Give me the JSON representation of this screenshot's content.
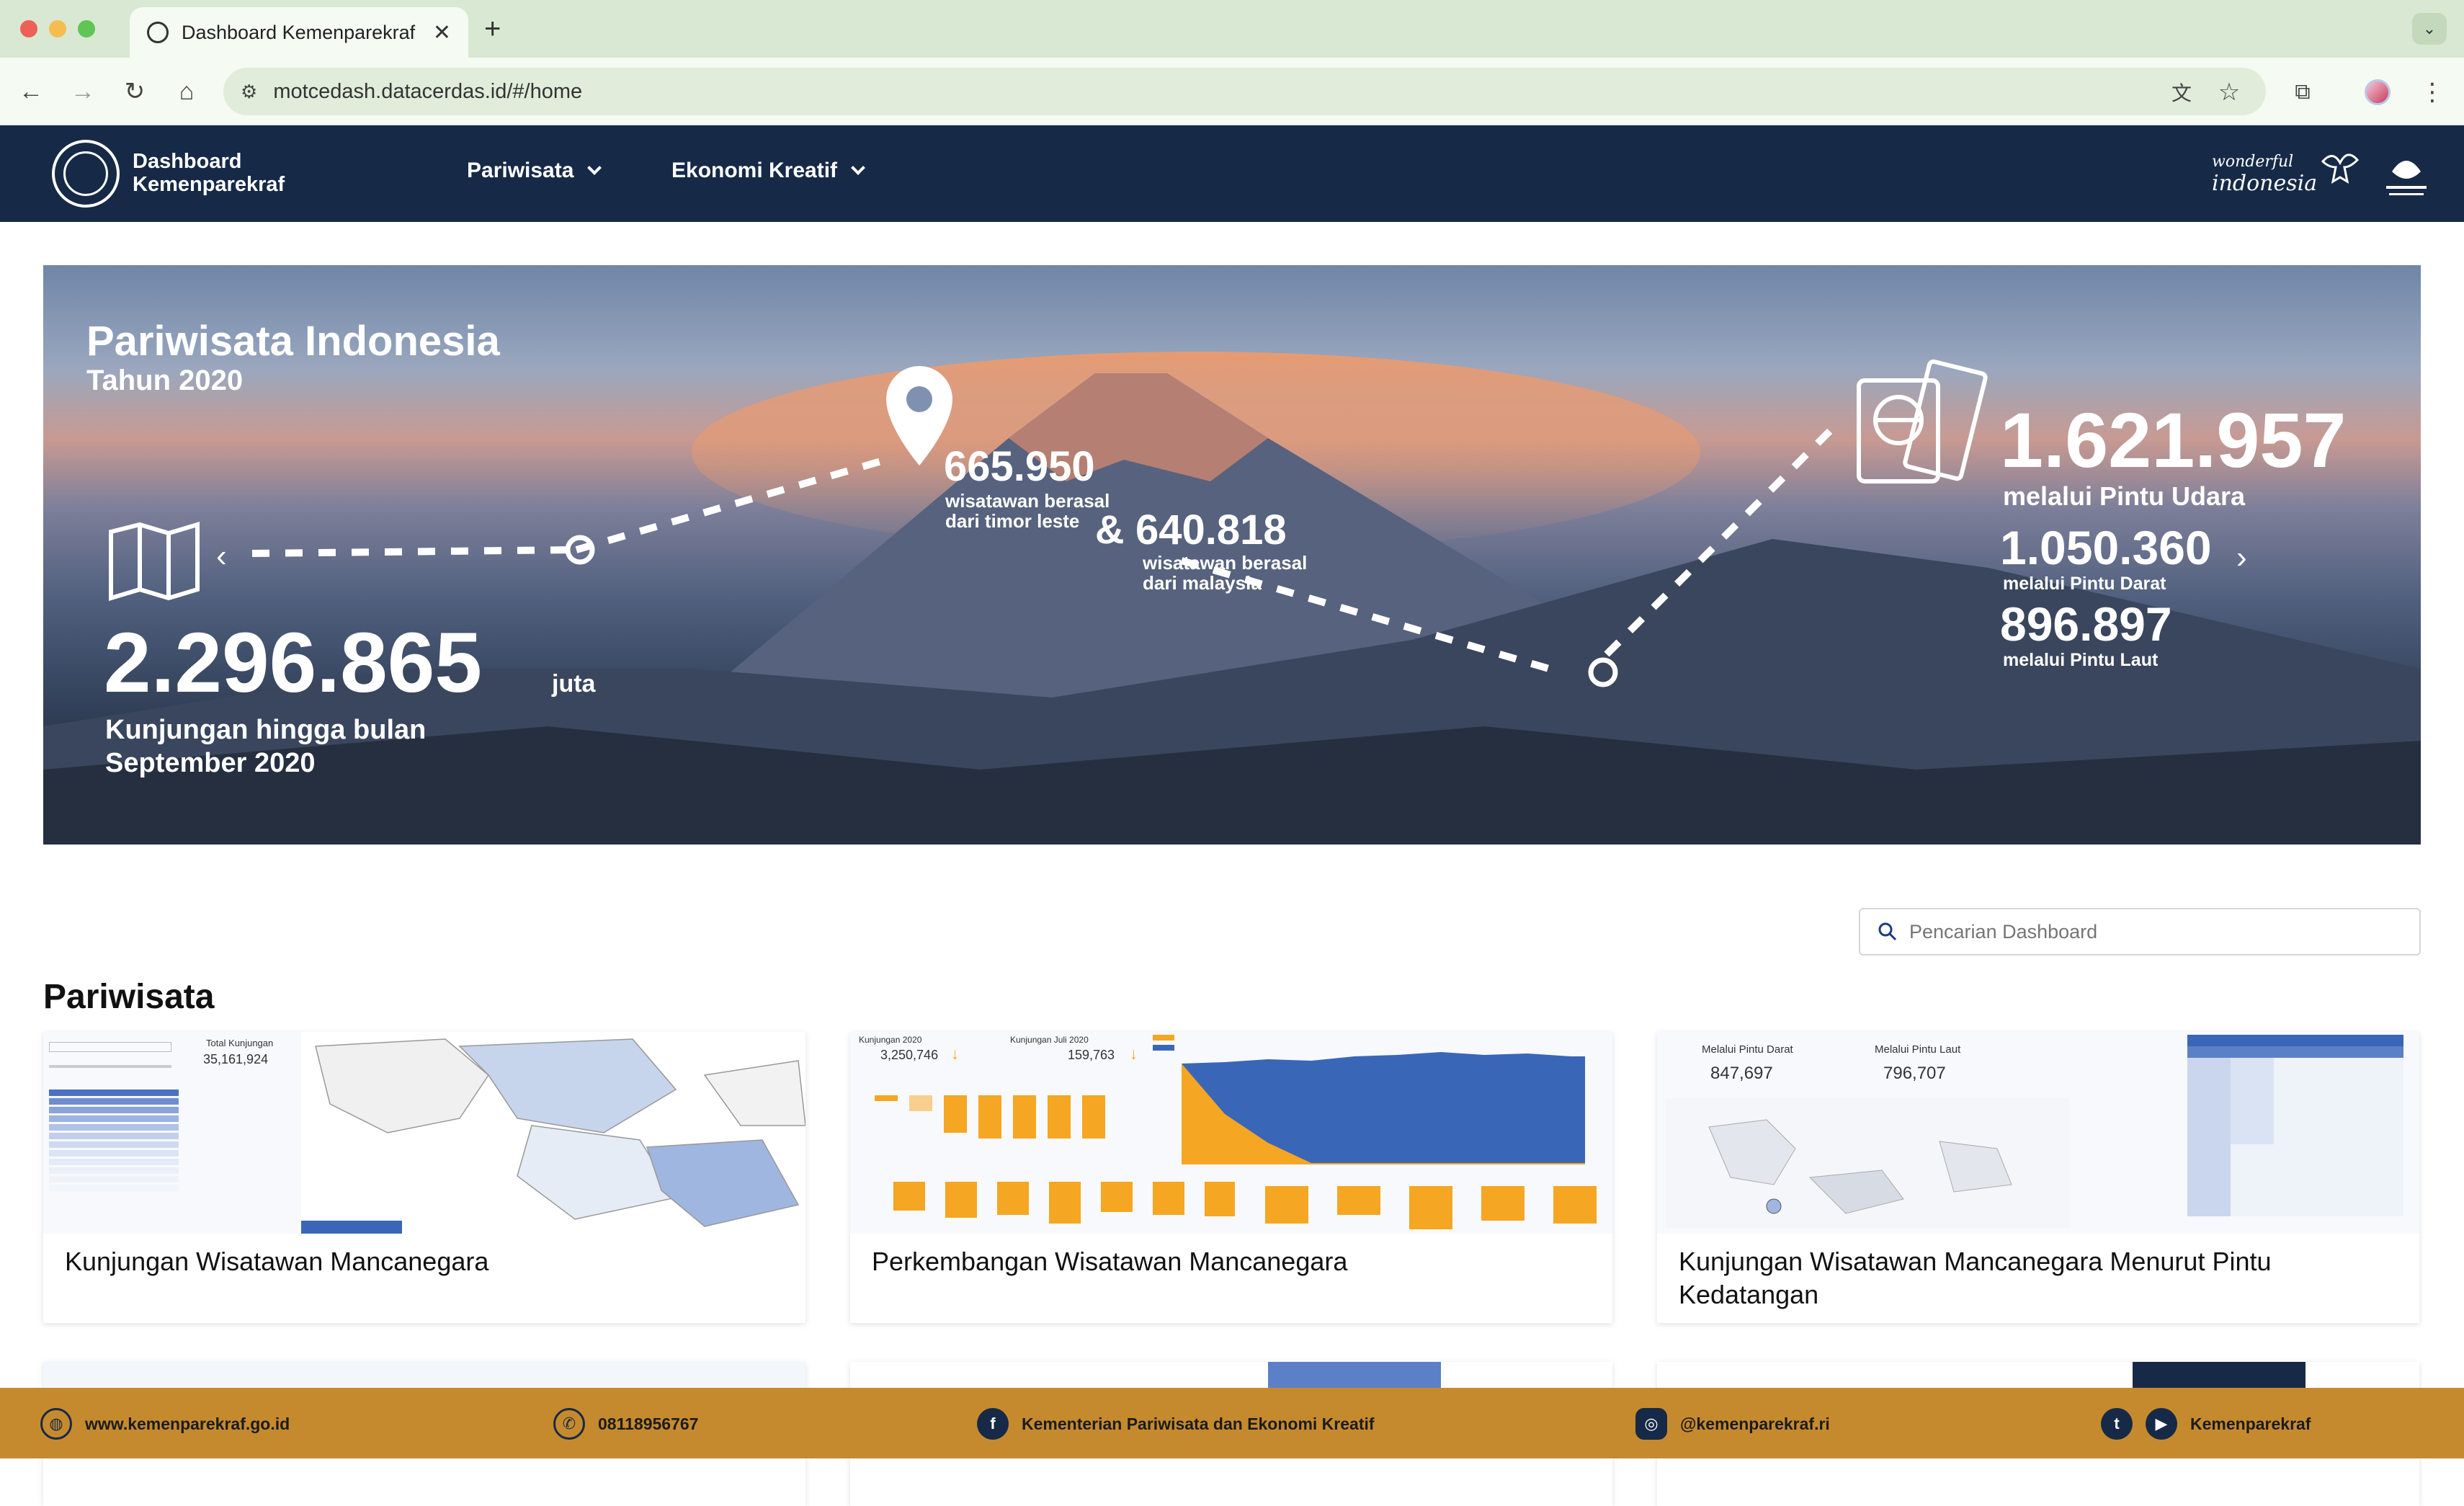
{
  "browser": {
    "tab_title": "Dashboard Kemenparekraf",
    "url": "motcedash.datacerdas.id/#/home"
  },
  "header": {
    "brand_line1": "Dashboard",
    "brand_line2": "Kemenparekraf",
    "menu": [
      "Pariwisata",
      "Ekonomi Kreatif"
    ],
    "wonderful_line1": "wonderful",
    "wonderful_line2": "indonesia"
  },
  "banner": {
    "title": "Pariwisata Indonesia",
    "year": "Tahun 2020",
    "total_value": "2.296.865",
    "total_unit": "juta",
    "total_caption_1": "Kunjungan hingga bulan",
    "total_caption_2": "September 2020",
    "timor_value": "665.950",
    "timor_caption_1": "wisatawan berasal",
    "timor_caption_2": "dari timor leste",
    "amp": "&",
    "malaysia_value": "640.818",
    "malaysia_caption_1": "wisatawan berasal",
    "malaysia_caption_2": "dari malaysia",
    "udara_value": "1.621.957",
    "udara_caption": "melalui Pintu Udara",
    "darat_value": "1.050.360",
    "darat_caption": "melalui Pintu Darat",
    "laut_value": "896.897",
    "laut_caption": "melalui Pintu Laut"
  },
  "search": {
    "placeholder": "Pencarian Dashboard"
  },
  "section": {
    "title": "Pariwisata"
  },
  "cards": [
    {
      "title": "Kunjungan Wisatawan Mancanegara",
      "thumb_label": "Total Kunjungan",
      "thumb_value": "35,161,924"
    },
    {
      "title": "Perkembangan Wisatawan Mancanegara",
      "thumb_left_label": "Kunjungan 2020",
      "thumb_left_value": "3,250,746",
      "thumb_right_label": "Kunjungan Juli 2020",
      "thumb_right_value": "159,763"
    },
    {
      "title": "Kunjungan Wisatawan Mancanegara Menurut Pintu Kedatangan",
      "thumb_left_label": "Melalui Pintu Darat",
      "thumb_left_value": "847,697",
      "thumb_right_label": "Melalui Pintu Laut",
      "thumb_right_value": "796,707"
    }
  ],
  "footer": {
    "website": "www.kemenparekraf.go.id",
    "phone": "08118956767",
    "facebook": "Kementerian Pariwisata dan Ekonomi Kreatif",
    "instagram": "@kemenparekraf.ri",
    "social": "Kemenparekraf"
  },
  "colors": {
    "header_bg": "#162a47",
    "footer_bg": "#c68a2e",
    "chart_orange": "#f5a623",
    "chart_blue": "#3a66b8"
  }
}
